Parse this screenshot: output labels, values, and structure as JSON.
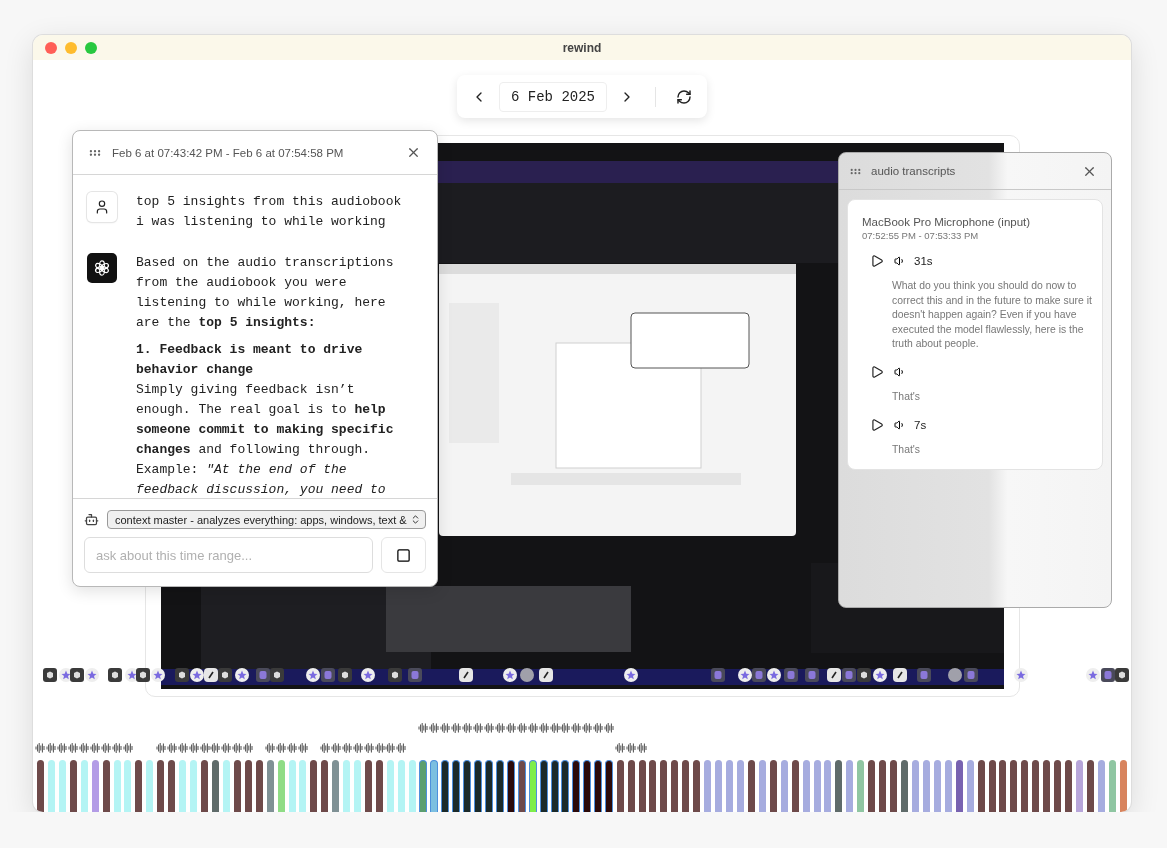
{
  "window": {
    "title": "rewind"
  },
  "date_nav": {
    "date": "6 Feb 2025"
  },
  "chat": {
    "range": "Feb 6 at 07:43:42 PM - Feb 6 at 07:54:58 PM",
    "messages": [
      {
        "kind": "user",
        "paragraphs": [
          {
            "kind": "text",
            "text": "top 5 insights from this audiobook i was listening to while working"
          }
        ]
      },
      {
        "kind": "assistant",
        "paragraphs": [
          {
            "kind": "text",
            "text": "Based on the audio transcriptions from the audiobook you were listening to while working, here are the **top 5 insights:**"
          },
          {
            "kind": "heading",
            "text": "1. Feedback is meant to drive behavior change"
          },
          {
            "kind": "text",
            "text": "Simply giving feedback isn’t enough. The real goal is to **help someone commit to making specific changes** and following through. Example: *\"At the end of the feedback discussion, you need to*"
          }
        ]
      }
    ],
    "model_select": "context master - analyzes everything: apps, windows, text &",
    "input": {
      "placeholder": "ask about this time range..."
    }
  },
  "transcripts": {
    "title": "audio transcripts",
    "device": "MacBook Pro Microphone (input)",
    "time_range": "07:52:55 PM - 07:53:33 PM",
    "entries": [
      {
        "duration": "31s",
        "text": "What do you think you should do now to correct this and in the future to make sure it doesn't happen again? Even if you have executed the model flawlessly, here is the truth about people."
      },
      {
        "text": "That's"
      },
      {
        "duration": "7s",
        "text": "That's"
      }
    ]
  },
  "timeline": {
    "bars": [
      {
        "color": "#6e4a4a",
        "selected": false,
        "audio": true
      },
      {
        "color": "#b4f4f4",
        "selected": false,
        "audio": true
      },
      {
        "color": "#b4f4f4",
        "selected": false,
        "audio": true
      },
      {
        "color": "#6e4a4a",
        "selected": false,
        "audio": true
      },
      {
        "color": "#b4f4f4",
        "selected": false,
        "audio": true
      },
      {
        "color": "#b39ce6",
        "selected": false,
        "audio": true
      },
      {
        "color": "#6e4a4a",
        "selected": false,
        "audio": true
      },
      {
        "color": "#b4f4f4",
        "selected": false,
        "audio": true
      },
      {
        "color": "#b4f4f4",
        "selected": false,
        "audio": true
      },
      {
        "color": "#6e4a4a",
        "selected": false,
        "audio": false
      },
      {
        "color": "#b4f4f4",
        "selected": false,
        "audio": false
      },
      {
        "color": "#6e4a4a",
        "selected": false,
        "audio": true
      },
      {
        "color": "#6e4a4a",
        "selected": false,
        "audio": true
      },
      {
        "color": "#b4f4f4",
        "selected": false,
        "audio": true
      },
      {
        "color": "#b4f4f4",
        "selected": false,
        "audio": true
      },
      {
        "color": "#6e4a4a",
        "selected": false,
        "audio": true
      },
      {
        "color": "#5f6b6a",
        "selected": false,
        "audio": true
      },
      {
        "color": "#b4f4f4",
        "selected": false,
        "audio": true
      },
      {
        "color": "#6e4a4a",
        "selected": false,
        "audio": true
      },
      {
        "color": "#6e4a4a",
        "selected": false,
        "audio": true
      },
      {
        "color": "#6e4a4a",
        "selected": false,
        "audio": false
      },
      {
        "color": "#7f9195",
        "selected": false,
        "audio": true
      },
      {
        "color": "#8fdc86",
        "selected": false,
        "audio": true
      },
      {
        "color": "#b4f4f4",
        "selected": false,
        "audio": true
      },
      {
        "color": "#b4f4f4",
        "selected": false,
        "audio": true
      },
      {
        "color": "#6e4a4a",
        "selected": false,
        "audio": false
      },
      {
        "color": "#6e4a4a",
        "selected": false,
        "audio": true
      },
      {
        "color": "#7f9195",
        "selected": false,
        "audio": true
      },
      {
        "color": "#b4f4f4",
        "selected": false,
        "audio": true
      },
      {
        "color": "#b4f4f4",
        "selected": false,
        "audio": true
      },
      {
        "color": "#6e4a4a",
        "selected": false,
        "audio": true
      },
      {
        "color": "#6e4a4a",
        "selected": false,
        "audio": true
      },
      {
        "color": "#b4f4f4",
        "selected": false,
        "audio": true
      },
      {
        "color": "#b4f4f4",
        "selected": false,
        "audio": true
      },
      {
        "color": "#b4f4f4",
        "selected": false,
        "audio": false
      },
      {
        "color": "#5b9e6f",
        "selected": true,
        "audio": true
      },
      {
        "color": "#7cbfe0",
        "selected": true,
        "audio": true
      },
      {
        "color": "#1b2a2a",
        "selected": true,
        "audio": true
      },
      {
        "color": "#1b2a2a",
        "selected": true,
        "audio": true
      },
      {
        "color": "#1b2a2a",
        "selected": true,
        "audio": true
      },
      {
        "color": "#1b2a2a",
        "selected": true,
        "audio": true
      },
      {
        "color": "#1b2a2a",
        "selected": true,
        "audio": true
      },
      {
        "color": "#1b2a2a",
        "selected": true,
        "audio": true
      },
      {
        "color": "#2b0a0a",
        "selected": true,
        "audio": true
      },
      {
        "color": "#6e4a4a",
        "selected": true,
        "audio": true
      },
      {
        "color": "#7eee4a",
        "selected": true,
        "audio": true
      },
      {
        "color": "#1b2a2a",
        "selected": true,
        "audio": true
      },
      {
        "color": "#1b2a2a",
        "selected": true,
        "audio": true
      },
      {
        "color": "#1b2a2a",
        "selected": true,
        "audio": true
      },
      {
        "color": "#2b0a0a",
        "selected": true,
        "audio": true
      },
      {
        "color": "#2b0a0a",
        "selected": true,
        "audio": true
      },
      {
        "color": "#2b0a0a",
        "selected": true,
        "audio": true
      },
      {
        "color": "#2b0a0a",
        "selected": true,
        "audio": true
      },
      {
        "color": "#6e4a4a",
        "selected": false,
        "audio": true
      },
      {
        "color": "#6e4a4a",
        "selected": false,
        "audio": true
      },
      {
        "color": "#6e4a4a",
        "selected": false,
        "audio": true
      },
      {
        "color": "#6e4a4a",
        "selected": false,
        "audio": false
      },
      {
        "color": "#6e4a4a",
        "selected": false,
        "audio": false
      },
      {
        "color": "#6e4a4a",
        "selected": false,
        "audio": false
      },
      {
        "color": "#6e4a4a",
        "selected": false,
        "audio": false
      },
      {
        "color": "#6e4a4a",
        "selected": false,
        "audio": false
      },
      {
        "color": "#a6acdf",
        "selected": false,
        "audio": false
      },
      {
        "color": "#a6acdf",
        "selected": false,
        "audio": false
      },
      {
        "color": "#a6acdf",
        "selected": false,
        "audio": false
      },
      {
        "color": "#a6acdf",
        "selected": false,
        "audio": false
      },
      {
        "color": "#6e4a4a",
        "selected": false,
        "audio": false
      },
      {
        "color": "#a6acdf",
        "selected": false,
        "audio": false
      },
      {
        "color": "#6e4a4a",
        "selected": false,
        "audio": false
      },
      {
        "color": "#a6acdf",
        "selected": false,
        "audio": false
      },
      {
        "color": "#6e4a4a",
        "selected": false,
        "audio": false
      },
      {
        "color": "#a6acdf",
        "selected": false,
        "audio": false
      },
      {
        "color": "#a6acdf",
        "selected": false,
        "audio": false
      },
      {
        "color": "#a6acdf",
        "selected": false,
        "audio": false
      },
      {
        "color": "#5f6b6a",
        "selected": false,
        "audio": false
      },
      {
        "color": "#a6acdf",
        "selected": false,
        "audio": false
      },
      {
        "color": "#8fc6a2",
        "selected": false,
        "audio": false
      },
      {
        "color": "#6e4a4a",
        "selected": false,
        "audio": false
      },
      {
        "color": "#6e4a4a",
        "selected": false,
        "audio": false
      },
      {
        "color": "#6e4a4a",
        "selected": false,
        "audio": false
      },
      {
        "color": "#5f6b6a",
        "selected": false,
        "audio": false
      },
      {
        "color": "#a6acdf",
        "selected": false,
        "audio": false
      },
      {
        "color": "#a6acdf",
        "selected": false,
        "audio": false
      },
      {
        "color": "#a6acdf",
        "selected": false,
        "audio": false
      },
      {
        "color": "#a6acdf",
        "selected": false,
        "audio": false
      },
      {
        "color": "#7862b0",
        "selected": false,
        "audio": false
      },
      {
        "color": "#a6acdf",
        "selected": false,
        "audio": false
      },
      {
        "color": "#6e4a4a",
        "selected": false,
        "audio": false
      },
      {
        "color": "#6e4a4a",
        "selected": false,
        "audio": false
      },
      {
        "color": "#6e4a4a",
        "selected": false,
        "audio": false
      },
      {
        "color": "#6e4a4a",
        "selected": false,
        "audio": false
      },
      {
        "color": "#6e4a4a",
        "selected": false,
        "audio": false
      },
      {
        "color": "#6e4a4a",
        "selected": false,
        "audio": false
      },
      {
        "color": "#6e4a4a",
        "selected": false,
        "audio": false
      },
      {
        "color": "#6e4a4a",
        "selected": false,
        "audio": false
      },
      {
        "color": "#6e4a4a",
        "selected": false,
        "audio": false
      },
      {
        "color": "#b8a6da",
        "selected": false,
        "audio": false
      },
      {
        "color": "#6e4a4a",
        "selected": false,
        "audio": false
      },
      {
        "color": "#a6acdf",
        "selected": false,
        "audio": false
      },
      {
        "color": "#8fc6a2",
        "selected": false,
        "audio": false
      },
      {
        "color": "#d8845e",
        "selected": false,
        "audio": false
      }
    ]
  }
}
